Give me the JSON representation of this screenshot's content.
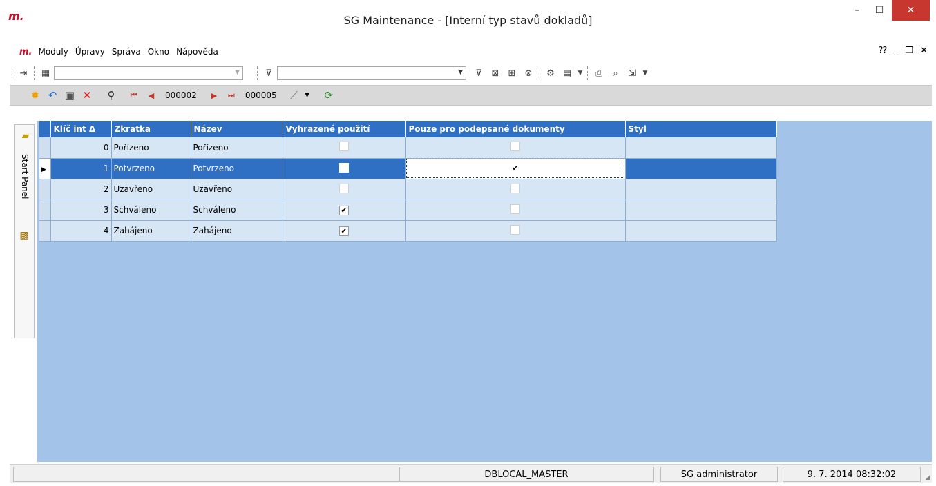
{
  "window": {
    "logo": "m.",
    "title": "SG Maintenance - [Interní typ stavů dokladů]",
    "minimize": "–",
    "maximize": "☐",
    "close": "✕"
  },
  "menu": {
    "logo": "m.",
    "items": [
      "Moduly",
      "Úpravy",
      "Správa",
      "Okno",
      "Nápověda"
    ],
    "help_icon": "⁇",
    "mdi_min": "_",
    "mdi_restore": "❐",
    "mdi_close": "✕"
  },
  "toolbar": {
    "combo1_value": "",
    "combo2_value": ""
  },
  "nav": {
    "current_record": "000002",
    "last_record": "000005"
  },
  "sidetab": {
    "label": "Start Panel"
  },
  "grid": {
    "columns": [
      "Klíč int",
      "Zkratka",
      "Název",
      "Vyhrazené použití",
      "Pouze pro podepsané dokumenty",
      "Styl"
    ],
    "sort_indicator": "Δ",
    "rows": [
      {
        "key": "0",
        "abbr": "Pořízeno",
        "name": "Pořízeno",
        "reserved": false,
        "signed_only": false,
        "style": ""
      },
      {
        "key": "1",
        "abbr": "Potvrzeno",
        "name": "Potvrzeno",
        "reserved": false,
        "signed_only": true,
        "style": ""
      },
      {
        "key": "2",
        "abbr": "Uzavřeno",
        "name": "Uzavřeno",
        "reserved": false,
        "signed_only": false,
        "style": ""
      },
      {
        "key": "3",
        "abbr": "Schváleno",
        "name": "Schváleno",
        "reserved": true,
        "signed_only": false,
        "style": ""
      },
      {
        "key": "4",
        "abbr": "Zahájeno",
        "name": "Zahájeno",
        "reserved": true,
        "signed_only": false,
        "style": ""
      }
    ],
    "selected_row": 1
  },
  "status": {
    "database": "DBLOCAL_MASTER",
    "user": "SG administrator",
    "datetime": "9. 7. 2014 08:32:02"
  },
  "colors": {
    "header_bg": "#2f6fc4",
    "grid_bg": "#a4c3e8",
    "close_btn": "#c7372f",
    "brand": "#c8102e"
  }
}
